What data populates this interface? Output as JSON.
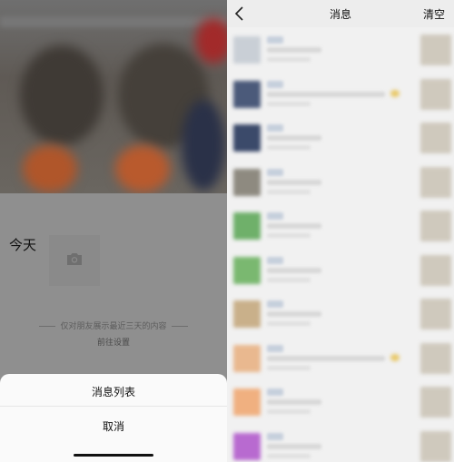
{
  "left_panel": {
    "today_label": "今天",
    "notice_text": "仅对朋友展示最近三天的内容",
    "goto_settings": "前往设置",
    "action_sheet": {
      "items": [
        "消息列表"
      ],
      "cancel": "取消"
    },
    "icons": [
      "camera-icon"
    ]
  },
  "right_panel": {
    "navbar": {
      "title": "消息",
      "clear": "清空",
      "back_icon": "chevron-left-icon"
    },
    "messages": [
      {
        "avatar_color": "#c9cfd6",
        "long": false,
        "emoji": false
      },
      {
        "avatar_color": "#4b5a7a",
        "long": true,
        "emoji": true
      },
      {
        "avatar_color": "#3b4a6a",
        "long": false,
        "emoji": false
      },
      {
        "avatar_color": "#8e8a80",
        "long": false,
        "emoji": false
      },
      {
        "avatar_color": "#6fb06a",
        "long": false,
        "emoji": false
      },
      {
        "avatar_color": "#7ab870",
        "long": false,
        "emoji": false
      },
      {
        "avatar_color": "#c9b08a",
        "long": false,
        "emoji": false
      },
      {
        "avatar_color": "#e9b88f",
        "long": true,
        "emoji": true
      },
      {
        "avatar_color": "#f0b080",
        "long": false,
        "emoji": false
      },
      {
        "avatar_color": "#b86ad0",
        "long": false,
        "emoji": false
      }
    ]
  }
}
